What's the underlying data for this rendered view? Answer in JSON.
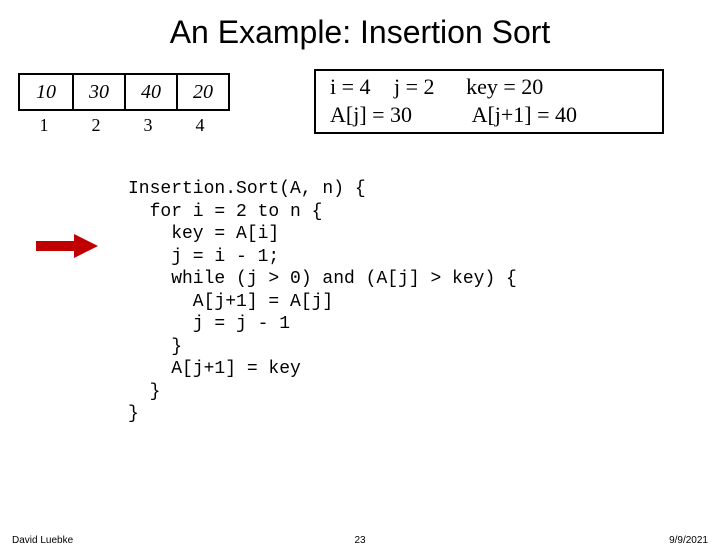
{
  "title": "An Example: Insertion Sort",
  "array": {
    "values": [
      "10",
      "30",
      "40",
      "20"
    ],
    "indices": [
      "1",
      "2",
      "3",
      "4"
    ]
  },
  "state": {
    "i": "i = 4",
    "j": "j = 2",
    "key": "key = 20",
    "aj": "A[j] = 30",
    "aj1": "A[j+1] = 40"
  },
  "code": {
    "l0": "Insertion.Sort(A, n) {",
    "l1": "  for i = 2 to n {",
    "l2": "    key = A[i]",
    "l3": "    j = i - 1;",
    "l4": "    while (j > 0) and (A[j] > key) {",
    "l5": "      A[j+1] = A[j]",
    "l6": "      j = j - 1",
    "l7": "    }",
    "l8": "    A[j+1] = key",
    "l9": "  }",
    "l10": "}"
  },
  "footer": {
    "author": "David Luebke",
    "slide": "23",
    "date": "9/9/2021"
  }
}
